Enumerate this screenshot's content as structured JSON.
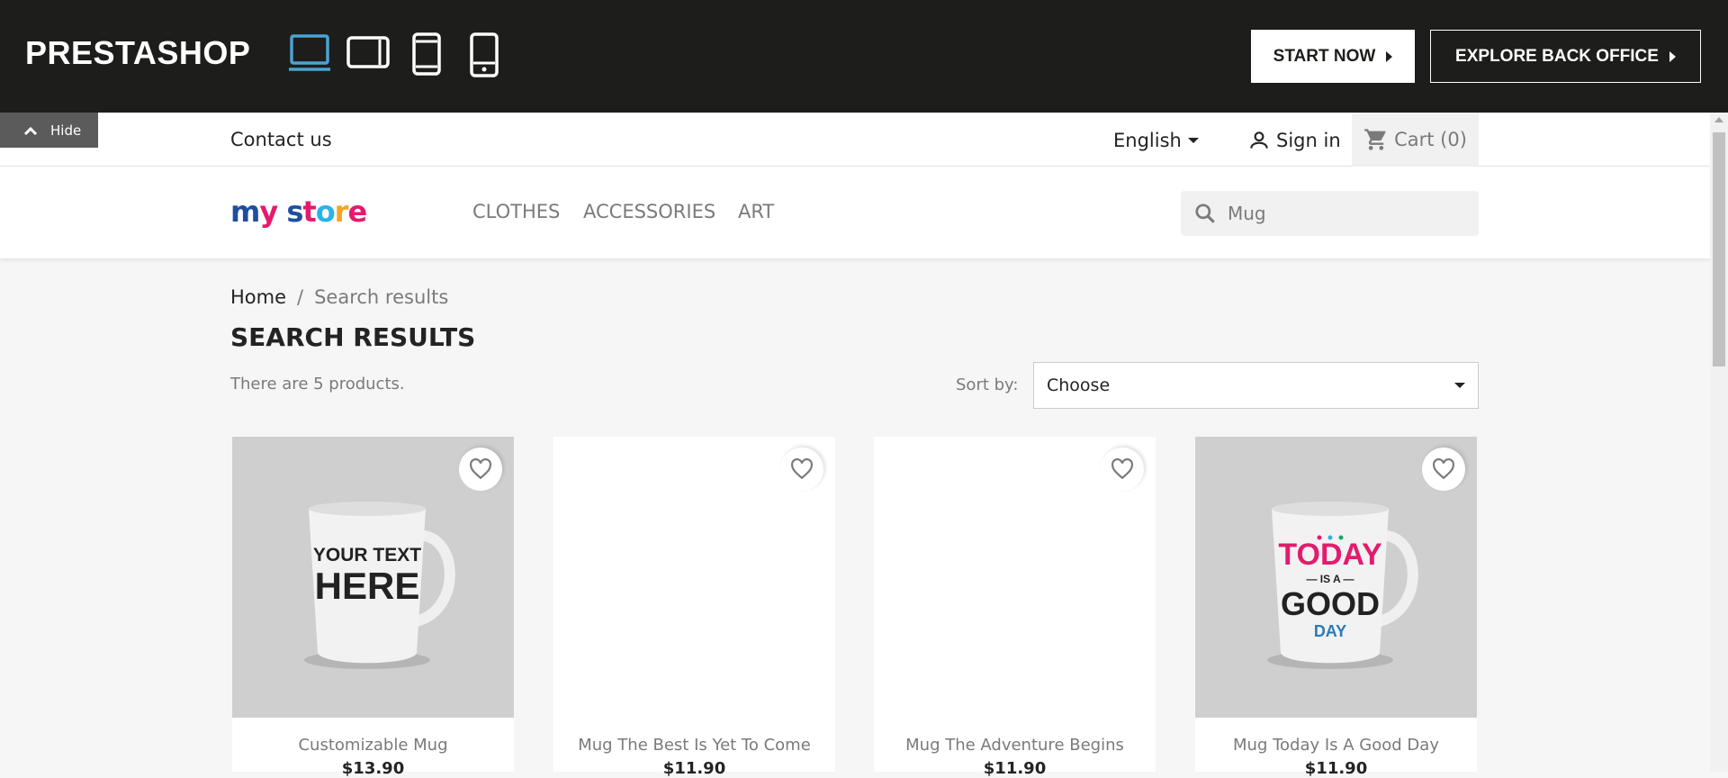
{
  "demo_bar": {
    "logo": "PRESTASHOP",
    "devices": [
      "desktop-icon",
      "tablet-landscape-icon",
      "tablet-portrait-icon",
      "mobile-icon"
    ],
    "start_now": "START NOW",
    "explore": "EXPLORE BACK OFFICE",
    "active_color": "#4aa3d1"
  },
  "hide_tab": {
    "label": "Hide"
  },
  "nav": {
    "contact": "Contact us",
    "language": "English",
    "sign_in": "Sign in",
    "cart": "Cart (0)"
  },
  "header": {
    "brand": "my store",
    "menu": [
      "CLOTHES",
      "ACCESSORIES",
      "ART"
    ],
    "search_value": "Mug"
  },
  "breadcrumb": {
    "home": "Home",
    "sep": "/",
    "current": "Search results"
  },
  "page": {
    "title": "SEARCH RESULTS",
    "count": "There are 5 products.",
    "sort_label": "Sort by:",
    "sort_value": "Choose"
  },
  "products": [
    {
      "name": "Customizable Mug",
      "price": "$13.90",
      "image": "YOUR TEXT HERE"
    },
    {
      "name": "Mug The Best Is Yet To Come",
      "price": "$11.90",
      "image": ""
    },
    {
      "name": "Mug The Adventure Begins",
      "price": "$11.90",
      "image": ""
    },
    {
      "name": "Mug Today Is A Good Day",
      "price": "$11.90",
      "image": "TODAY IS A GOOD DAY"
    }
  ]
}
